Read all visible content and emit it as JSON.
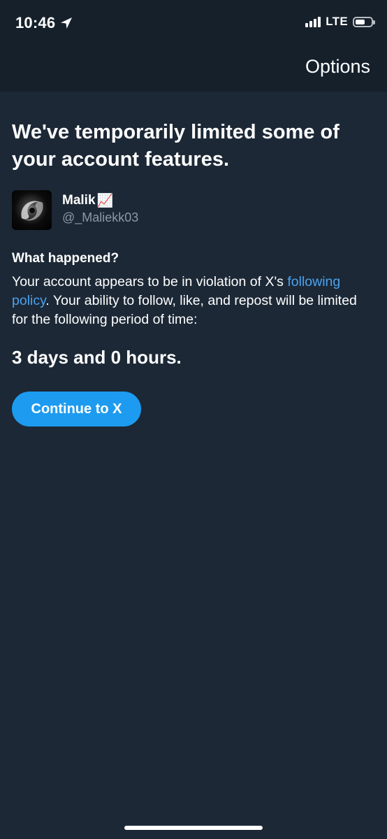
{
  "status_bar": {
    "time": "10:46",
    "network": "LTE",
    "location_icon": "location-arrow-icon",
    "signal_icon": "cellular-signal-icon",
    "battery_icon": "battery-icon"
  },
  "header": {
    "options_label": "Options"
  },
  "main": {
    "heading": "We've temporarily limited some of your account features.",
    "user": {
      "name": "Malik",
      "name_emoji": "📈",
      "handle": "@_Maliekk03"
    },
    "what_happened_title": "What happened?",
    "description_before_link": "Your account appears to be in violation of X's ",
    "link_text": "following policy",
    "description_after_link": ". Your ability to follow, like, and repost will be limited for the following period of time:",
    "duration": "3 days and 0 hours.",
    "continue_label": "Continue to X"
  },
  "colors": {
    "background": "#1c2836",
    "header_background": "#15202b",
    "accent": "#1d9bf0",
    "link": "#4aa3ef",
    "secondary_text": "#8b98a5"
  },
  "battery_level": 0.6
}
